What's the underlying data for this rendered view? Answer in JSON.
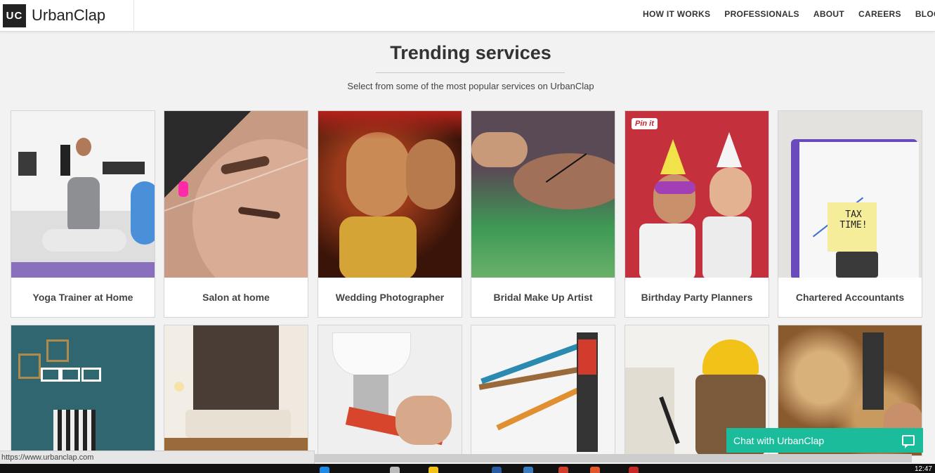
{
  "brand": {
    "logo_text": "UC",
    "name": "UrbanClap"
  },
  "nav": [
    "HOW IT WORKS",
    "PROFESSIONALS",
    "ABOUT",
    "CAREERS",
    "BLOG"
  ],
  "main": {
    "title": "Trending services",
    "subtitle": "Select from some of the most popular services on UrbanClap"
  },
  "services_row1": [
    {
      "label": "Yoga Trainer at Home",
      "icon": "yoga-photo"
    },
    {
      "label": "Salon at home",
      "icon": "salon-photo"
    },
    {
      "label": "Wedding Photographer",
      "icon": "wedding-photo"
    },
    {
      "label": "Bridal Make Up Artist",
      "icon": "makeup-photo"
    },
    {
      "label": "Birthday Party Planners",
      "icon": "party-photo",
      "badge": "Pin it"
    },
    {
      "label": "Chartered Accountants",
      "icon": "tax-photo"
    }
  ],
  "services_row2": [
    {
      "icon": "interior-frames-photo"
    },
    {
      "icon": "living-room-photo"
    },
    {
      "icon": "plumber-photo"
    },
    {
      "icon": "electrician-photo"
    },
    {
      "icon": "worker-hardhat-photo"
    },
    {
      "icon": "carpenter-photo"
    }
  ],
  "tax_note": "TAX TIME!",
  "chat": {
    "label": "Chat with UrbanClap"
  },
  "status_url": "https://www.urbanclap.com",
  "taskbar_time": "12:47",
  "colors": {
    "accent": "#1bbc9b",
    "header_bg": "#ffffff",
    "page_bg": "#f2f2f2"
  }
}
